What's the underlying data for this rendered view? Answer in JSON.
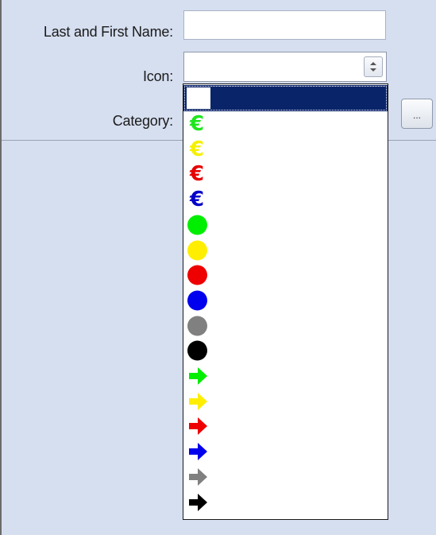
{
  "form": {
    "name_label": "Last and First Name:",
    "name_value": "",
    "icon_label": "Icon:",
    "icon_value": "",
    "category_label": "Category:",
    "category_button": "..."
  },
  "icon_dropdown": {
    "selected_index": 0,
    "items": [
      {
        "kind": "blank",
        "name": "blank"
      },
      {
        "kind": "euro",
        "color": "#1ee61e"
      },
      {
        "kind": "euro",
        "color": "#f5f000"
      },
      {
        "kind": "euro",
        "color": "#e60000"
      },
      {
        "kind": "euro",
        "color": "#0000c8"
      },
      {
        "kind": "circle",
        "color": "#00ee00"
      },
      {
        "kind": "circle",
        "color": "#ffee00"
      },
      {
        "kind": "circle",
        "color": "#ee0000"
      },
      {
        "kind": "circle",
        "color": "#0000ee"
      },
      {
        "kind": "circle",
        "color": "#808080"
      },
      {
        "kind": "circle",
        "color": "#000000"
      },
      {
        "kind": "arrow",
        "color": "#00ee00"
      },
      {
        "kind": "arrow",
        "color": "#ffee00"
      },
      {
        "kind": "arrow",
        "color": "#ee0000"
      },
      {
        "kind": "arrow",
        "color": "#0000ee"
      },
      {
        "kind": "arrow",
        "color": "#808080"
      },
      {
        "kind": "arrow",
        "color": "#000000"
      }
    ]
  },
  "colors": {
    "background": "#d6dff0",
    "selection": "#0a246a"
  }
}
